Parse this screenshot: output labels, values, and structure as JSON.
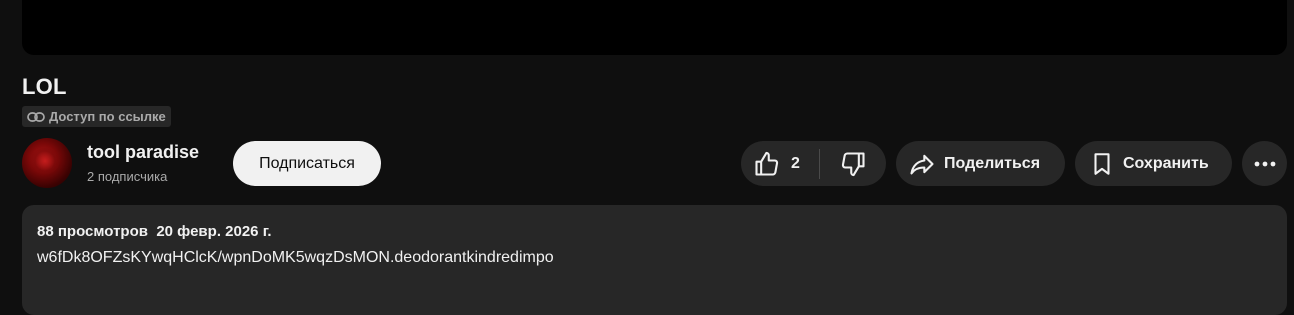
{
  "video": {
    "title": "LOL",
    "access_label": "Доступ по ссылке"
  },
  "channel": {
    "name": "tool paradise",
    "subscribers": "2 подписчика",
    "subscribe_label": "Подписаться"
  },
  "actions": {
    "like_count": "2",
    "share_label": "Поделиться",
    "save_label": "Сохранить"
  },
  "description": {
    "views": "88 просмотров",
    "date": "20 февр. 2026 г.",
    "text": "w6fDk8OFZsKYwqHClcK/wpnDoMK5wqzDsMON.deodorantkindredimpo"
  },
  "colors": {
    "background": "#0f0f0f",
    "surface": "#272727",
    "text": "#f1f1f1",
    "muted": "#aaaaaa"
  }
}
